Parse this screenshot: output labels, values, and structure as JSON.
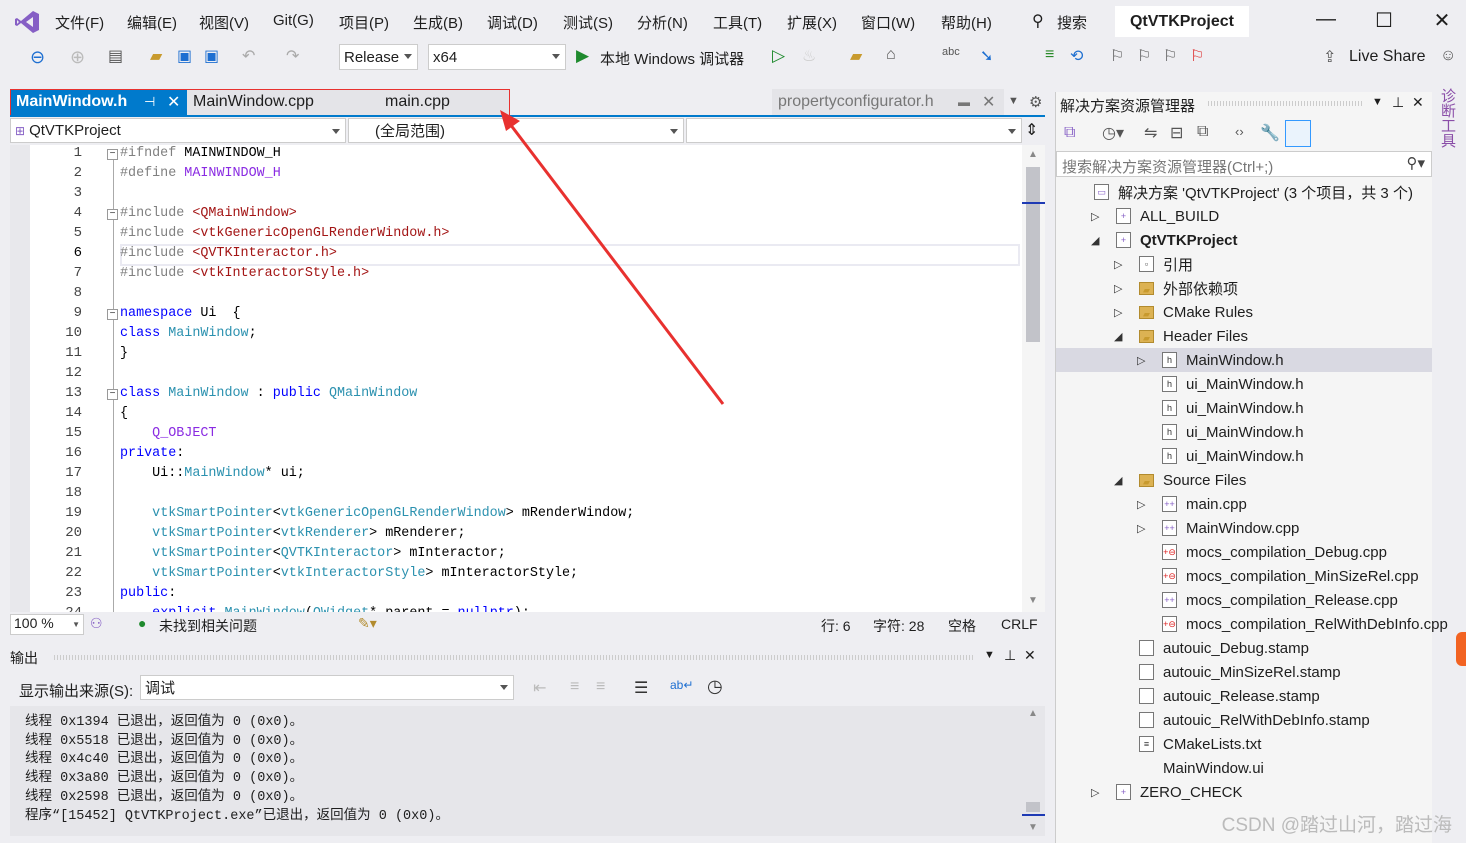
{
  "menu": [
    "文件(F)",
    "编辑(E)",
    "视图(V)",
    "Git(G)",
    "项目(P)",
    "生成(B)",
    "调试(D)",
    "测试(S)",
    "分析(N)",
    "工具(T)",
    "扩展(X)",
    "窗口(W)",
    "帮助(H)"
  ],
  "search_label": "搜索",
  "window_title": "QtVTKProject",
  "toolbar": {
    "config": "Release",
    "platform": "x64",
    "debugger": "本地 Windows 调试器",
    "live_share": "Live Share"
  },
  "tabs": [
    {
      "label": "MainWindow.h",
      "active": true
    },
    {
      "label": "MainWindow.cpp"
    },
    {
      "label": "main.cpp"
    }
  ],
  "overflow_tab": "propertyconfigurator.h",
  "nav": {
    "project": "QtVTKProject",
    "scope": "(全局范围)",
    "member": ""
  },
  "code_lines": [
    [
      [
        "#ifndef ",
        "pp"
      ],
      [
        "MAINWINDOW_H",
        "tx"
      ]
    ],
    [
      [
        "#define ",
        "pp"
      ],
      [
        "MAINWINDOW_H",
        "mac"
      ]
    ],
    [],
    [
      [
        "#include ",
        "pp"
      ],
      [
        "<QMainWindow>",
        "st"
      ]
    ],
    [
      [
        "#include ",
        "pp"
      ],
      [
        "<vtkGenericOpenGLRenderWindow.h>",
        "st"
      ]
    ],
    [
      [
        "#include ",
        "pp"
      ],
      [
        "<QVTKInteractor.h>",
        "st"
      ]
    ],
    [
      [
        "#include ",
        "pp"
      ],
      [
        "<vtkInteractorStyle.h>",
        "st"
      ]
    ],
    [],
    [
      [
        "namespace",
        "kw"
      ],
      [
        " Ui  {",
        "tx"
      ]
    ],
    [
      [
        "class ",
        "kw"
      ],
      [
        "MainWindow",
        "ty"
      ],
      [
        ";",
        "tx"
      ]
    ],
    [
      [
        "}",
        "tx"
      ]
    ],
    [],
    [
      [
        "class ",
        "kw"
      ],
      [
        "MainWindow",
        "ty"
      ],
      [
        " : ",
        "tx"
      ],
      [
        "public ",
        "kw"
      ],
      [
        "QMainWindow",
        "ty"
      ]
    ],
    [
      [
        "{",
        "tx"
      ]
    ],
    [
      [
        "    ",
        "tx"
      ],
      [
        "Q_OBJECT",
        "mac"
      ]
    ],
    [
      [
        "private",
        "kw"
      ],
      [
        ":",
        "tx"
      ]
    ],
    [
      [
        "    Ui::",
        "tx"
      ],
      [
        "MainWindow",
        "ty"
      ],
      [
        "* ui;",
        "tx"
      ]
    ],
    [],
    [
      [
        "    ",
        "tx"
      ],
      [
        "vtkSmartPointer",
        "ty"
      ],
      [
        "<",
        "tx"
      ],
      [
        "vtkGenericOpenGLRenderWindow",
        "ty"
      ],
      [
        "> mRenderWindow;",
        "tx"
      ]
    ],
    [
      [
        "    ",
        "tx"
      ],
      [
        "vtkSmartPointer",
        "ty"
      ],
      [
        "<",
        "tx"
      ],
      [
        "vtkRenderer",
        "ty"
      ],
      [
        "> mRenderer;",
        "tx"
      ]
    ],
    [
      [
        "    ",
        "tx"
      ],
      [
        "vtkSmartPointer",
        "ty"
      ],
      [
        "<",
        "tx"
      ],
      [
        "QVTKInteractor",
        "ty"
      ],
      [
        "> mInteractor;",
        "tx"
      ]
    ],
    [
      [
        "    ",
        "tx"
      ],
      [
        "vtkSmartPointer",
        "ty"
      ],
      [
        "<",
        "tx"
      ],
      [
        "vtkInteractorStyle",
        "ty"
      ],
      [
        "> mInteractorStyle;",
        "tx"
      ]
    ],
    [
      [
        "public",
        "kw"
      ],
      [
        ":",
        "tx"
      ]
    ],
    [
      [
        "    ",
        "tx"
      ],
      [
        "explicit ",
        "kw"
      ],
      [
        "MainWindow",
        "ty"
      ],
      [
        "(",
        "tx"
      ],
      [
        "QWidget",
        "ty"
      ],
      [
        "* parent = ",
        "tx"
      ],
      [
        "nullptr",
        "kw"
      ],
      [
        ");",
        "tx"
      ]
    ]
  ],
  "status": {
    "zoom": "100 %",
    "issues": "未找到相关问题",
    "line": "行: 6",
    "char": "字符: 28",
    "spaces": "空格",
    "eol": "CRLF"
  },
  "output": {
    "title": "输出",
    "source_label": "显示输出来源(S):",
    "source_value": "调试",
    "lines": [
      "线程 0x1394 已退出，返回值为 0 (0x0)。",
      "线程 0x5518 已退出，返回值为 0 (0x0)。",
      "线程 0x4c40 已退出，返回值为 0 (0x0)。",
      "线程 0x3a80 已退出，返回值为 0 (0x0)。",
      "线程 0x2598 已退出，返回值为 0 (0x0)。",
      "程序“[15452] QtVTKProject.exe”已退出，返回值为 0 (0x0)。"
    ]
  },
  "solution_explorer": {
    "title": "解决方案资源管理器",
    "search_placeholder": "搜索解决方案资源管理器(Ctrl+;)",
    "items": [
      {
        "label": "解决方案 'QtVTKProject' (3 个项目，共 3 个)",
        "level": 0,
        "icon": "solution-icon",
        "arrow": "none"
      },
      {
        "label": "ALL_BUILD",
        "level": 1,
        "icon": "project-icon",
        "arrow": "collapsed"
      },
      {
        "label": "QtVTKProject",
        "level": 1,
        "icon": "project-icon",
        "arrow": "expanded",
        "bold": true
      },
      {
        "label": "引用",
        "level": 2,
        "icon": "references-icon",
        "arrow": "collapsed"
      },
      {
        "label": "外部依赖项",
        "level": 2,
        "icon": "folder-icon",
        "arrow": "collapsed"
      },
      {
        "label": "CMake Rules",
        "level": 2,
        "icon": "filter-folder-icon",
        "arrow": "collapsed"
      },
      {
        "label": "Header Files",
        "level": 2,
        "icon": "filter-folder-icon",
        "arrow": "expanded"
      },
      {
        "label": "MainWindow.h",
        "level": 3,
        "icon": "header-file-icon",
        "arrow": "collapsed",
        "selected": true
      },
      {
        "label": "ui_MainWindow.h",
        "level": 3,
        "icon": "header-file-icon",
        "arrow": "none"
      },
      {
        "label": "ui_MainWindow.h",
        "level": 3,
        "icon": "header-file-icon",
        "arrow": "none"
      },
      {
        "label": "ui_MainWindow.h",
        "level": 3,
        "icon": "header-file-icon",
        "arrow": "none"
      },
      {
        "label": "ui_MainWindow.h",
        "level": 3,
        "icon": "header-file-icon",
        "arrow": "none"
      },
      {
        "label": "Source Files",
        "level": 2,
        "icon": "filter-folder-icon",
        "arrow": "expanded"
      },
      {
        "label": "main.cpp",
        "level": 3,
        "icon": "cpp-file-icon",
        "arrow": "collapsed"
      },
      {
        "label": "MainWindow.cpp",
        "level": 3,
        "icon": "cpp-file-icon",
        "arrow": "collapsed"
      },
      {
        "label": "mocs_compilation_Debug.cpp",
        "level": 3,
        "icon": "cpp-excluded-icon",
        "arrow": "none"
      },
      {
        "label": "mocs_compilation_MinSizeRel.cpp",
        "level": 3,
        "icon": "cpp-excluded-icon",
        "arrow": "none"
      },
      {
        "label": "mocs_compilation_Release.cpp",
        "level": 3,
        "icon": "cpp-file-icon",
        "arrow": "none"
      },
      {
        "label": "mocs_compilation_RelWithDebInfo.cpp",
        "level": 3,
        "icon": "cpp-excluded-icon",
        "arrow": "none"
      },
      {
        "label": "autouic_Debug.stamp",
        "level": 2,
        "icon": "file-icon",
        "arrow": "none"
      },
      {
        "label": "autouic_MinSizeRel.stamp",
        "level": 2,
        "icon": "file-icon",
        "arrow": "none"
      },
      {
        "label": "autouic_Release.stamp",
        "level": 2,
        "icon": "file-icon",
        "arrow": "none"
      },
      {
        "label": "autouic_RelWithDebInfo.stamp",
        "level": 2,
        "icon": "file-icon",
        "arrow": "none"
      },
      {
        "label": "CMakeLists.txt",
        "level": 2,
        "icon": "text-file-icon",
        "arrow": "none"
      },
      {
        "label": "MainWindow.ui",
        "level": 2,
        "icon": "none",
        "arrow": "none"
      },
      {
        "label": "ZERO_CHECK",
        "level": 1,
        "icon": "project-icon",
        "arrow": "collapsed"
      }
    ]
  },
  "side_tab": "诊断工具",
  "watermark": "CSDN @踏过山河，踏过海",
  "colors": {
    "accent": "#007acc",
    "annotation": "#e8312f",
    "vs_purple": "#865fc5"
  }
}
